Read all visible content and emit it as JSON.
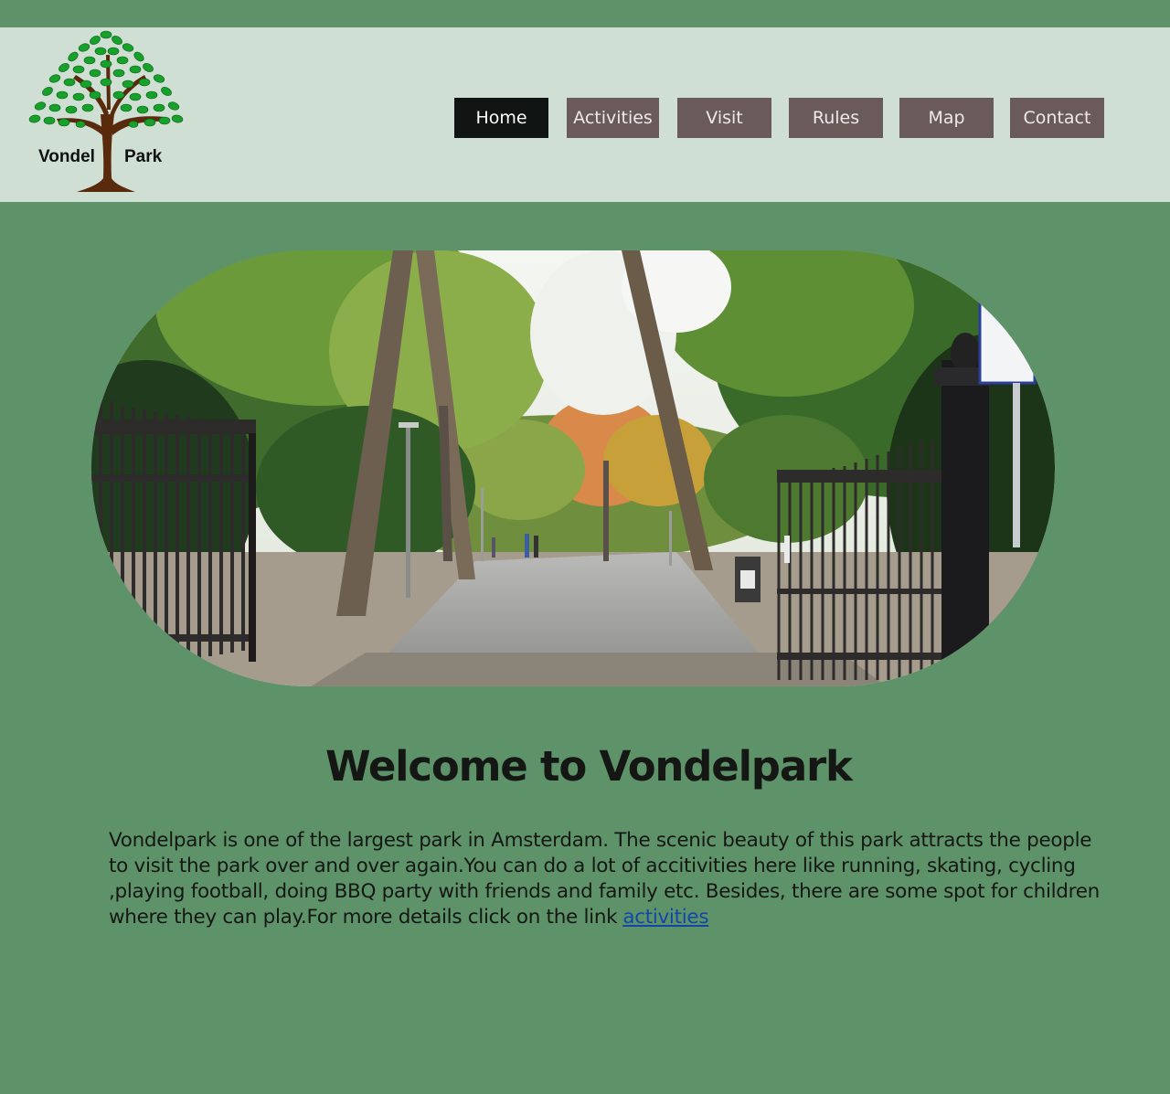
{
  "logo": {
    "word_left": "Vondel",
    "word_right": "Park",
    "icon": "tree-icon"
  },
  "nav": {
    "items": [
      {
        "label": "Home",
        "active": true
      },
      {
        "label": "Activities",
        "active": false
      },
      {
        "label": "Visit",
        "active": false
      },
      {
        "label": "Rules",
        "active": false
      },
      {
        "label": "Map",
        "active": false
      },
      {
        "label": "Contact",
        "active": false
      }
    ]
  },
  "hero": {
    "icon": "park-entrance-photo"
  },
  "main": {
    "title": "Welcome to Vondelpark",
    "paragraph": "Vondelpark is one of the largest park in Amsterdam. The scenic beauty of this park attracts the people to visit the park over and over again.You can do a lot of accitivities here  like running, skating, cycling ,playing football, doing BBQ party with friends and family etc. Besides, there are some spot for children where they can play.For more details click on the link",
    "link_label": "activities"
  },
  "colors": {
    "page_bg": "#5e936a",
    "header_bg": "#cfdfd3",
    "nav_bg": "#6b5a5a",
    "nav_active_bg": "#101412",
    "link": "#1346a8"
  }
}
